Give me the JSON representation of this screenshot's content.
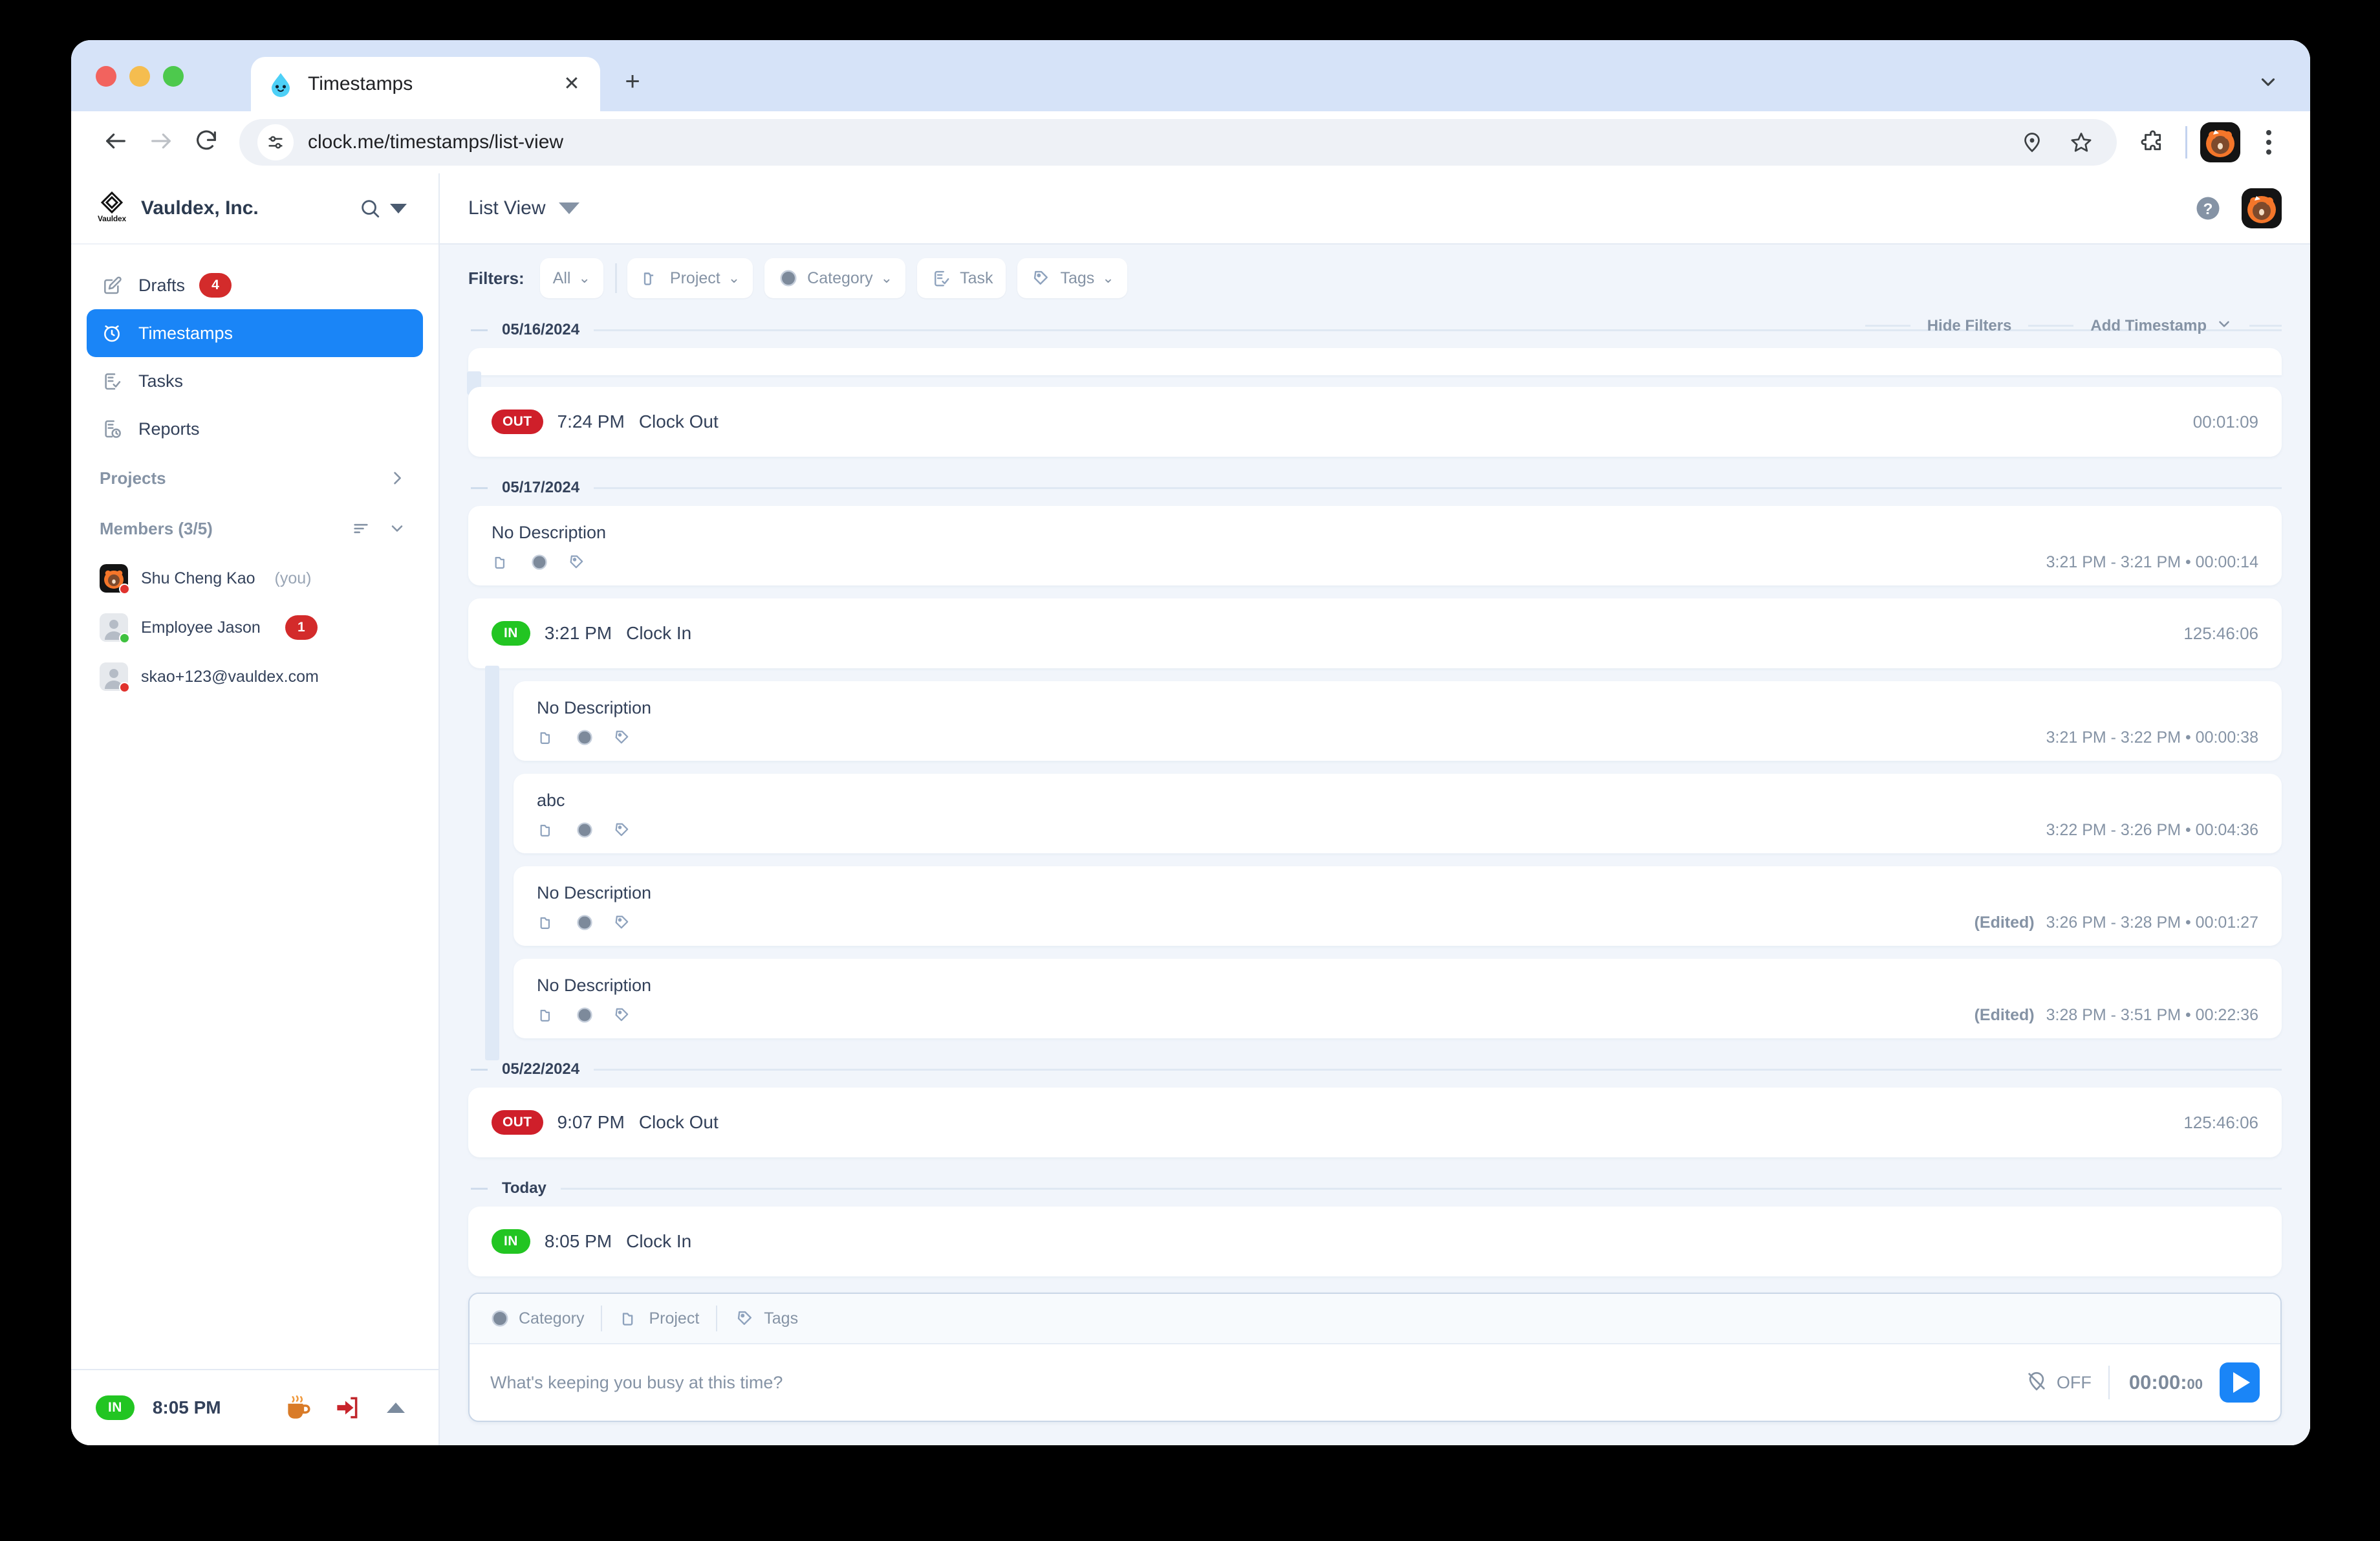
{
  "browser": {
    "tab_title": "Timestamps",
    "tab_favicon": "water-drop-face-icon",
    "close_label": "✕",
    "new_tab_label": "+",
    "url": "clock.me/timestamps/list-view",
    "back_icon": "back-arrow-icon",
    "forward_icon": "forward-arrow-icon",
    "reload_icon": "reload-icon",
    "site_info_icon": "tune-icon",
    "location_icon": "location-pin-icon",
    "bookmark_icon": "star-icon",
    "extensions_icon": "puzzle-piece-icon",
    "profile_icon": "bear-avatar-icon",
    "menu_icon": "three-dot-menu-icon",
    "tab_list_icon": "chevron-down-icon"
  },
  "sidebar": {
    "org_name": "Vauldex, Inc.",
    "org_logo_word": "Vauldex",
    "search_icon": "search-icon",
    "org_caret_icon": "caret-down-icon",
    "nav": [
      {
        "label": "Drafts",
        "icon": "draft-pencil-icon",
        "badge": "4",
        "active": false
      },
      {
        "label": "Timestamps",
        "icon": "alarm-clock-icon",
        "badge": "",
        "active": true
      },
      {
        "label": "Tasks",
        "icon": "task-list-icon",
        "badge": "",
        "active": false
      },
      {
        "label": "Reports",
        "icon": "report-clock-icon",
        "badge": "",
        "active": false
      }
    ],
    "projects": {
      "title": "Projects",
      "chevron_icon": "chevron-right-icon"
    },
    "members": {
      "title": "Members (3/5)",
      "sort_icon": "sort-icon",
      "collapse_icon": "chevron-down-icon",
      "list": [
        {
          "name": "Shu Cheng Kao",
          "suffix": "(you)",
          "status": "offline",
          "badge": "",
          "avatar": "bear-avatar-icon"
        },
        {
          "name": "Employee Jason",
          "suffix": "",
          "status": "online",
          "badge": "1",
          "avatar": "default-person-icon"
        },
        {
          "name": "skao+123@vauldex.com",
          "suffix": "",
          "status": "offline",
          "badge": "",
          "avatar": "default-person-icon"
        }
      ]
    },
    "status_bar": {
      "state": "IN",
      "time": "8:05 PM",
      "coffee_icon": "coffee-cup-icon",
      "clockout_icon": "clock-out-arrow-icon",
      "collapse_icon": "caret-up-icon"
    }
  },
  "header": {
    "view_label": "List View",
    "view_caret_icon": "caret-down-icon",
    "help_icon": "help-question-icon",
    "avatar_icon": "bear-avatar-icon"
  },
  "filters": {
    "label": "Filters:",
    "chips": [
      {
        "label": "All",
        "icon": "",
        "caret": true
      },
      {
        "label": "Project",
        "icon": "folder-icon",
        "caret": true
      },
      {
        "label": "Category",
        "icon": "circle-icon",
        "caret": true
      },
      {
        "label": "Task",
        "icon": "task-list-icon",
        "caret": false
      },
      {
        "label": "Tags",
        "icon": "tag-icon",
        "caret": true
      }
    ],
    "hide_filters_label": "Hide Filters",
    "add_timestamp_label": "Add Timestamp",
    "add_timestamp_caret_icon": "chevron-down-icon"
  },
  "list": {
    "groups": [
      {
        "date": "05/16/2024",
        "rows": [
          {
            "type": "partial-card"
          },
          {
            "type": "clock",
            "state": "OUT",
            "time": "7:24 PM",
            "action": "Clock Out",
            "duration": "00:01:09",
            "indent": false
          }
        ]
      },
      {
        "date": "05/17/2024",
        "rows": [
          {
            "type": "entry",
            "desc": "No Description",
            "edited": "",
            "range": "3:21 PM -  3:21 PM • 00:00:14",
            "indent": false
          },
          {
            "type": "clock",
            "state": "IN",
            "time": "3:21 PM",
            "action": "Clock In",
            "duration": "125:46:06",
            "indent": false
          },
          {
            "type": "entry",
            "desc": "No Description",
            "edited": "",
            "range": "3:21 PM -  3:22 PM • 00:00:38",
            "indent": true
          },
          {
            "type": "entry",
            "desc": "abc",
            "edited": "",
            "range": "3:22 PM -  3:26 PM • 00:04:36",
            "indent": true
          },
          {
            "type": "entry",
            "desc": "No Description",
            "edited": "(Edited)",
            "range": "3:26 PM -  3:28 PM • 00:01:27",
            "indent": true
          },
          {
            "type": "entry",
            "desc": "No Description",
            "edited": "(Edited)",
            "range": "3:28 PM -  3:51 PM • 00:22:36",
            "indent": true
          }
        ]
      },
      {
        "date": "05/22/2024",
        "rows": [
          {
            "type": "clock",
            "state": "OUT",
            "time": "9:07 PM",
            "action": "Clock Out",
            "duration": "125:46:06",
            "indent": false
          }
        ]
      },
      {
        "date": "Today",
        "rows": [
          {
            "type": "clock",
            "state": "IN",
            "time": "8:05 PM",
            "action": "Clock In",
            "duration": "",
            "indent": false
          }
        ]
      }
    ]
  },
  "composer": {
    "chips": [
      {
        "label": "Category",
        "icon": "circle-icon"
      },
      {
        "label": "Project",
        "icon": "folder-icon"
      },
      {
        "label": "Tags",
        "icon": "tag-icon"
      }
    ],
    "placeholder": "What's keeping you busy at this time?",
    "gps_label": "OFF",
    "gps_icon": "location-off-icon",
    "timer_main": "00:00:",
    "timer_secs": "00",
    "start_icon": "play-icon"
  },
  "colors": {
    "accent": "#1a85f7",
    "in_green": "#22c522",
    "out_red": "#cf1f2a",
    "badge_red": "#d32b2b",
    "page_bg": "#f1f5fb"
  }
}
